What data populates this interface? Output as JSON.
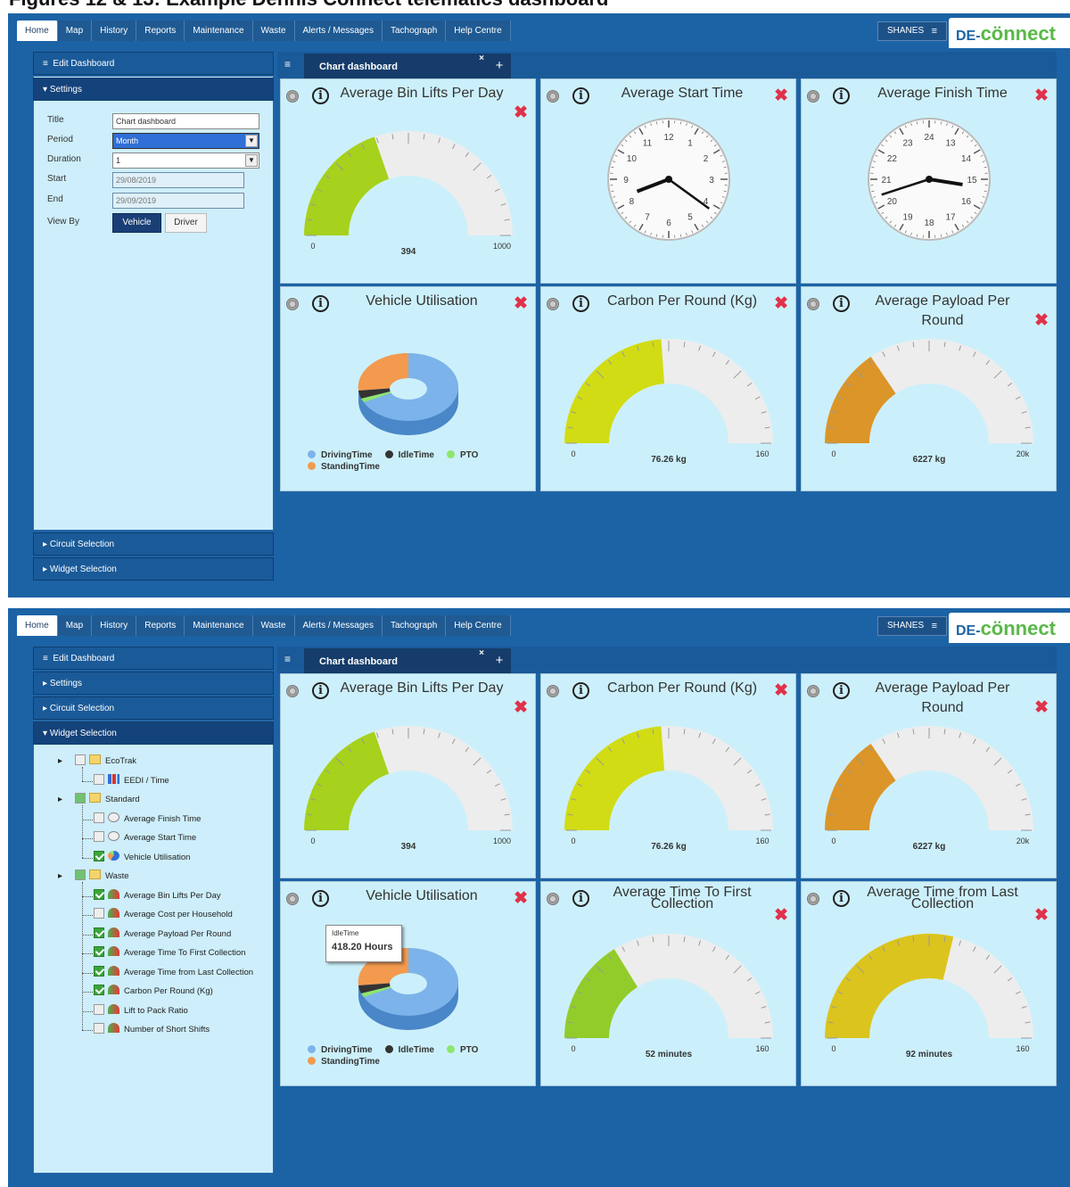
{
  "figure_title": "Figures 12 & 13: Example Dennis Connect telematics dashboard",
  "nav_tabs": [
    "Home",
    "Map",
    "History",
    "Reports",
    "Maintenance",
    "Waste",
    "Alerts / Messages",
    "Tachograph",
    "Help Centre"
  ],
  "user": {
    "name": "SHANES",
    "menu_icon": "≡"
  },
  "logo": {
    "part1": "DE-",
    "part2": "cönnect"
  },
  "sidebar": {
    "edit_dashboard": "Edit Dashboard",
    "settings": "Settings",
    "circuit_selection": "Circuit Selection",
    "widget_selection": "Widget Selection"
  },
  "settings_form": {
    "title_label": "Title",
    "title_value": "Chart dashboard",
    "period_label": "Period",
    "period_value": "Month",
    "duration_label": "Duration",
    "duration_value": "1",
    "start_label": "Start",
    "start_value": "29/08/2019",
    "end_label": "End",
    "end_value": "29/09/2019",
    "view_by_label": "View By",
    "vehicle_btn": "Vehicle",
    "driver_btn": "Driver"
  },
  "dashboard_tab": {
    "label": "Chart dashboard",
    "close": "×",
    "add": "+"
  },
  "screen1": {
    "widgets": [
      {
        "title": "Average Bin Lifts Per Day",
        "type": "gauge",
        "value": 394,
        "max": 1000,
        "label": "394",
        "min_label": "0",
        "max_label": "1000",
        "color": "#a6d11c"
      },
      {
        "title": "Average Start Time",
        "type": "clock",
        "numbers": [
          "12",
          "1",
          "2",
          "3",
          "4",
          "5",
          "6",
          "7",
          "8",
          "9",
          "10",
          "11"
        ],
        "hour": 8.3,
        "minute": 21
      },
      {
        "title": "Average Finish Time",
        "type": "clock",
        "numbers": [
          "24",
          "13",
          "14",
          "15",
          "16",
          "17",
          "18",
          "19",
          "20",
          "21",
          "22",
          "23"
        ],
        "hour": 15.3,
        "minute": 42
      },
      {
        "title": "Vehicle Utilisation",
        "type": "donut"
      },
      {
        "title": "Carbon Per Round (Kg)",
        "type": "gauge",
        "value": 76.26,
        "max": 160,
        "label": "76.26 kg",
        "min_label": "0",
        "max_label": "160",
        "color": "#d1dc14"
      },
      {
        "title": "Average Payload Per Round",
        "type": "gauge",
        "value": 6227,
        "max": 20000,
        "label": "6227 kg",
        "min_label": "0",
        "max_label": "20k",
        "color": "#db9528"
      }
    ]
  },
  "screen2": {
    "widgets": [
      {
        "title": "Average Bin Lifts Per Day",
        "type": "gauge",
        "value": 394,
        "max": 1000,
        "label": "394",
        "min_label": "0",
        "max_label": "1000",
        "color": "#a6d11c"
      },
      {
        "title": "Carbon Per Round (Kg)",
        "type": "gauge",
        "value": 76.26,
        "max": 160,
        "label": "76.26 kg",
        "min_label": "0",
        "max_label": "160",
        "color": "#d1dc14"
      },
      {
        "title": "Average Payload Per Round",
        "type": "gauge",
        "value": 6227,
        "max": 20000,
        "label": "6227 kg",
        "min_label": "0",
        "max_label": "20k",
        "color": "#db9528"
      },
      {
        "title": "Vehicle Utilisation",
        "type": "donut"
      },
      {
        "title": "Average Time To First Collection",
        "type": "gauge",
        "value": 52,
        "max": 160,
        "label": "52 minutes",
        "min_label": "0",
        "max_label": "160",
        "color": "#92cc2a"
      },
      {
        "title": "Average Time from Last Collection",
        "type": "gauge",
        "value": 92,
        "max": 160,
        "label": "92 minutes",
        "min_label": "0",
        "max_label": "160",
        "color": "#dcc41e"
      }
    ]
  },
  "donut_legend": [
    {
      "name": "DrivingTime",
      "color": "#7cb3ea"
    },
    {
      "name": "IdleTime",
      "color": "#333333"
    },
    {
      "name": "PTO",
      "color": "#8ee56e"
    },
    {
      "name": "StandingTime",
      "color": "#f39a4f"
    }
  ],
  "tooltip": {
    "label": "IdleTime",
    "value": "418.20 Hours"
  },
  "widget_tree": [
    {
      "label": "EcoTrak",
      "level": 0,
      "checked": "none",
      "icon": "folder"
    },
    {
      "label": "EEDI / Time",
      "level": 1,
      "checked": "none",
      "icon": "bar"
    },
    {
      "label": "Standard",
      "level": 0,
      "checked": "partial",
      "icon": "folder"
    },
    {
      "label": "Average Finish Time",
      "level": 1,
      "checked": "none",
      "icon": "clock"
    },
    {
      "label": "Average Start Time",
      "level": 1,
      "checked": "none",
      "icon": "clock"
    },
    {
      "label": "Vehicle Utilisation",
      "level": 1,
      "checked": "on",
      "icon": "pie"
    },
    {
      "label": "Waste",
      "level": 0,
      "checked": "partial",
      "icon": "folder"
    },
    {
      "label": "Average Bin Lifts Per Day",
      "level": 1,
      "checked": "on",
      "icon": "gauge"
    },
    {
      "label": "Average Cost per Household",
      "level": 1,
      "checked": "none",
      "icon": "gauge"
    },
    {
      "label": "Average Payload Per Round",
      "level": 1,
      "checked": "on",
      "icon": "gauge"
    },
    {
      "label": "Average Time To First Collection",
      "level": 1,
      "checked": "on",
      "icon": "gauge"
    },
    {
      "label": "Average Time from Last Collection",
      "level": 1,
      "checked": "on",
      "icon": "gauge"
    },
    {
      "label": "Carbon Per Round (Kg)",
      "level": 1,
      "checked": "on",
      "icon": "gauge"
    },
    {
      "label": "Lift to Pack Ratio",
      "level": 1,
      "checked": "none",
      "icon": "gauge"
    },
    {
      "label": "Number of Short Shifts",
      "level": 1,
      "checked": "none",
      "icon": "gauge"
    }
  ]
}
